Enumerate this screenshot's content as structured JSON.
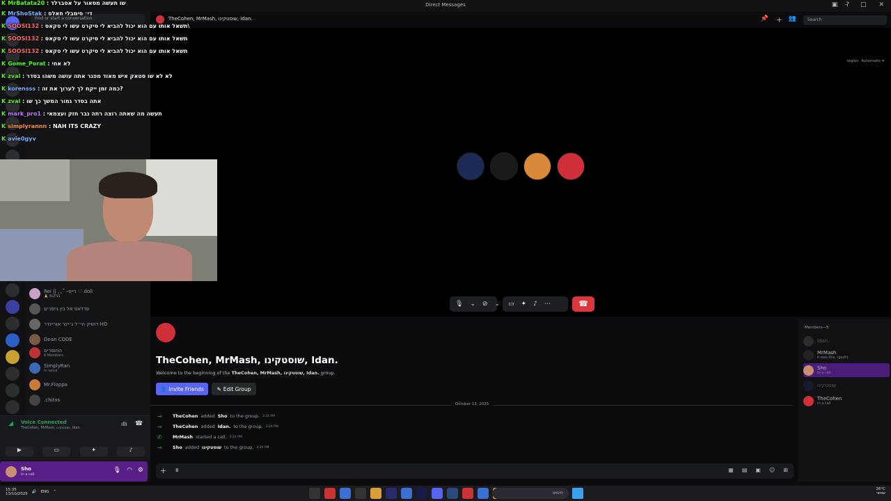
{
  "window": {
    "title": "Direct Messages"
  },
  "sidebar": {
    "search_placeholder": "Find or start a conversation",
    "dms": [
      {
        "name": "Rei || ,.,˚ ˖רייס ♡ doll",
        "sub": "🙏 BLESS"
      },
      {
        "name": "פרדאס אל בין גיימרים",
        "sub": ""
      },
      {
        "name": "דושיק הי״ל ג׳יינר אוריינדר HD",
        "sub": ""
      },
      {
        "name": "Dean CODE",
        "sub": ""
      },
      {
        "name": "החומרים",
        "sub": "6 Members"
      },
      {
        "name": "SimplyRan",
        "sub": "In voice"
      },
      {
        "name": "Mr.Floppa",
        "sub": ""
      },
      {
        "name": ".chitos",
        "sub": ""
      }
    ]
  },
  "voice": {
    "status": "Voice Connected",
    "channel": "TheCohen, MrMash, שוסטקינו, Idan."
  },
  "user": {
    "name": "Sho",
    "status": "In a call"
  },
  "header": {
    "channel_name": "TheCohen, MrMash, שוסטקינו, Idan.",
    "search_placeholder": "Search",
    "region_label": "region",
    "region_value": "Automatic"
  },
  "chat": {
    "group_name": "TheCohen, MrMash, שוסטקינו, Idan.",
    "welcome_prefix": "Welcome to the beginning of the",
    "welcome_group": "TheCohen, MrMash, שוסטקינו, Idan.",
    "welcome_suffix": "group.",
    "invite_label": "Invite Friends",
    "edit_label": "Edit Group",
    "date_divider": "October 13, 2025",
    "messages": [
      {
        "actor": "TheCohen",
        "verb": "added",
        "target": "Sho",
        "rest": "to the group.",
        "time": "3:24 PM"
      },
      {
        "actor": "TheCohen",
        "verb": "added",
        "target": "Idan.",
        "rest": "to the group.",
        "time": "3:24 PM"
      },
      {
        "actor": "MrMash",
        "verb": "started a call.",
        "target": "",
        "rest": "",
        "time": "3:24 PM"
      },
      {
        "actor": "Sho",
        "verb": "added",
        "target": "שוסטקינו",
        "rest": "to the group.",
        "time": "3:29 PM"
      }
    ],
    "input_value": "8"
  },
  "members": {
    "header": "Members—5",
    "list": [
      {
        "name": "Idan.",
        "status": ""
      },
      {
        "name": "MrMash",
        "status": "it was dns. (gosh)"
      },
      {
        "name": "Sho",
        "status": "In a call"
      },
      {
        "name": "שוסטקינו",
        "status": ""
      },
      {
        "name": "TheCohen",
        "status": "In a call"
      }
    ]
  },
  "stream_chat": [
    {
      "user": "MrBatata20",
      "msg": "שו תעשה מסאור על אסברלד"
    },
    {
      "user": "MrShoStak",
      "msg": "די׳ סימבלי חאלס"
    },
    {
      "user": "SOOSI132",
      "msg": "תשאל אותו עם הוא יכול להביא לי סיקרט עשו לי סקאס\\"
    },
    {
      "user": "SOOSI132",
      "msg": "תשאל אותו עם הוא יכול להביא לי סיקרט עשו לי סקאס"
    },
    {
      "user": "SOOSI132",
      "msg": "תשאל אותו עם הוא יכול להביא לי סיקרט עשו לי סקאס"
    },
    {
      "user": "Gome_Porat",
      "msg": "לא אחי"
    },
    {
      "user": "zval",
      "msg": "לא לא שו סטאק איש מאוד מפגר אתה עושה משהו בסדר"
    },
    {
      "user": "korensss",
      "msg": "כמה זמן ייקח לך לערוך את זה?"
    },
    {
      "user": "zval",
      "msg": "אתה בסדר גמור המשך כך שו"
    },
    {
      "user": "mark_pro1",
      "msg": "תעשה מה שאתה רוצה רתה גבר חזק ועצמאי"
    },
    {
      "user": "simplyrannn",
      "msg": "NAH ITS CRAZY"
    },
    {
      "user": "avie0gyv",
      "msg": ""
    }
  ],
  "taskbar": {
    "time": "15:35",
    "date": "13/10/2025",
    "lang": "ENG",
    "search_placeholder": "חיפוש",
    "weather": "26°C",
    "weather_sub": "שמשי"
  },
  "colors": {
    "accent": "#5865f2",
    "hangup": "#da373c",
    "online": "#23a559",
    "kick_green": "#53fc18",
    "user_panel": "#5a1f86"
  }
}
